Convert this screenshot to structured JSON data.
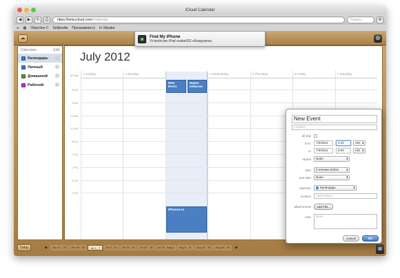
{
  "window": {
    "title": "iCloud Calendar"
  },
  "browser": {
    "url_host": "https://",
    "url_domain": "beta.icloud.com",
    "url_path": "/#calendar",
    "search_placeholder": "Яндекс",
    "bookmarks": [
      "Objective-C",
      "Selfjeedie",
      "Программисту",
      "In Siteabe"
    ]
  },
  "notification": {
    "title": "Find My iPhone",
    "subtitle": "Устройство iPad snake002 обнаружено."
  },
  "sidebar": {
    "header_left": "Calendars",
    "header_right": "Edit",
    "items": [
      {
        "label": "Календарь",
        "color": "#3f78c9",
        "selected": true
      },
      {
        "label": "Личный",
        "color": "#3f78c9",
        "selected": false
      },
      {
        "label": "Домашний",
        "color": "#5a8a3c",
        "selected": false
      },
      {
        "label": "Рабочий",
        "color": "#a33fb0",
        "selected": false
      }
    ],
    "today_button": "Today"
  },
  "calendar": {
    "month_title": "July 2012",
    "all_day_label": "all-day",
    "days": [
      "1 Sunday",
      "2 Monday",
      "3 Tuesday",
      "4 Wednesday",
      "5 Thursday",
      "6 Friday",
      "7 Saturday"
    ],
    "today_index": 2,
    "hours": [
      "8 AM",
      "9 AM",
      "10 AM",
      "11 AM",
      "Noon",
      "1 PM",
      "2 PM",
      "3 PM",
      "4 PM"
    ],
    "events": [
      {
        "label": "New Event"
      },
      {
        "label": "Новое событие"
      },
      {
        "label": "iPhones.ru"
      }
    ],
    "weeks": [
      "Jun 17 - 23",
      "Jun 24 - 30",
      "Jul 1 - 7",
      "Jul 8 - 14",
      "Jul 15 - 21",
      "Jul 22 - 28",
      "Jul 29 - Aug 4",
      "Aug 5 - 11",
      "Aug 12 - 18",
      "Aug 19 - 25"
    ],
    "selected_week_index": 2
  },
  "popup": {
    "title": "New Event",
    "location_placeholder": "Location",
    "all_day_label": "all-day",
    "from_label": "from",
    "from_date": "7/3/2012",
    "from_time": "4:10",
    "from_ampm": "AM",
    "to_label": "to",
    "to_date": "7/3/2012",
    "to_time": "6:00",
    "to_ampm": "AM",
    "repeat_label": "repeat",
    "repeat_value": "None",
    "alert_label": "alert",
    "alert_value": "5 minutes before",
    "alert2_label": "2nd alert",
    "alert2_value": "None",
    "calendar_label": "calendar",
    "calendar_value": "Календарь",
    "invitees_label": "invitees",
    "invitees_placeholder": "Add Invitee...",
    "attachments_label": "attachments",
    "attachments_button": "Add File...",
    "note_label": "note",
    "note_placeholder": "None",
    "cancel_button": "Cancel",
    "ok_button": "OK"
  }
}
